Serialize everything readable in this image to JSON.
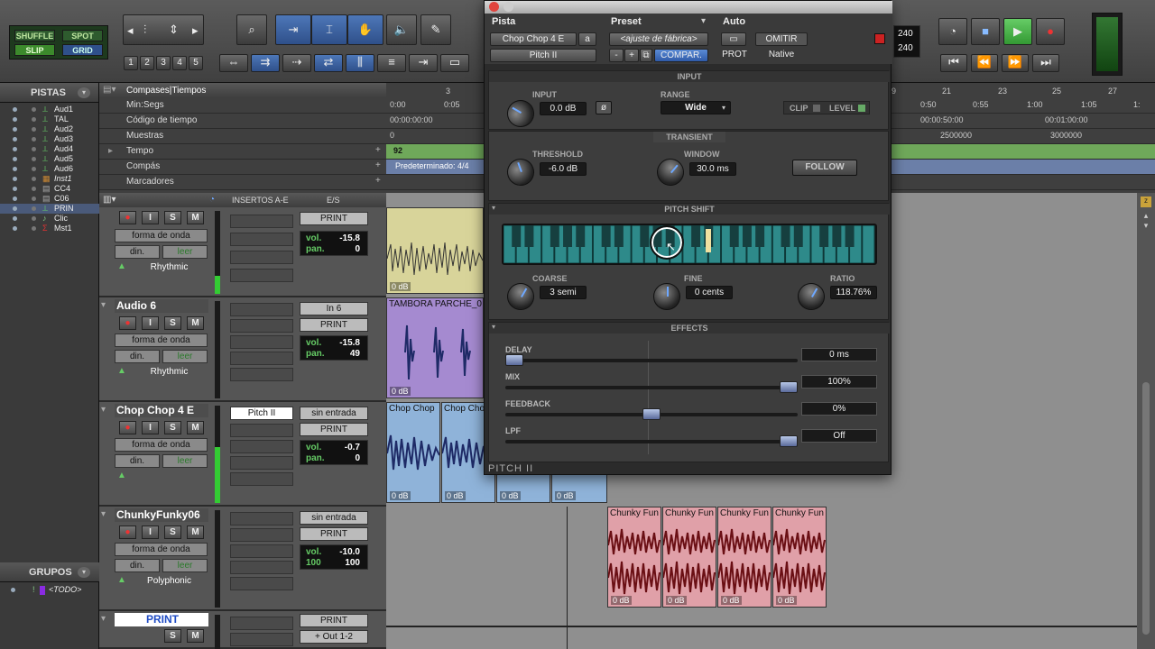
{
  "toolbar": {
    "modes": [
      "SHUFFLE",
      "SPOT",
      "SLIP",
      "GRID"
    ],
    "zoom_presets": [
      "1",
      "2",
      "3",
      "4",
      "5"
    ],
    "counter_top": "240",
    "counter_bottom": "240"
  },
  "left": {
    "tracks_header": "PISTAS",
    "track_list": [
      "Aud1",
      "TAL",
      "Aud2",
      "Aud3",
      "Aud4",
      "Aud5",
      "Aud6",
      "Inst1",
      "CC4",
      "C06",
      "PRIN",
      "Clic",
      "Mst1"
    ],
    "groups_header": "GRUPOS",
    "group_item": "<TODO>"
  },
  "rulers": {
    "header": "Compases|Tiempos",
    "rows": [
      "Min:Segs",
      "Código de tiempo",
      "Muestras",
      "Tempo",
      "Compás",
      "Marcadores"
    ],
    "bars_left": [
      "3"
    ],
    "bars_right": [
      "9",
      "21",
      "23",
      "25",
      "27"
    ],
    "minsecs_left": [
      "0:00",
      "0:05"
    ],
    "minsecs_right": [
      "0:50",
      "0:55",
      "1:00",
      "1:05",
      "1:"
    ],
    "timecode_left": "00:00:00:00",
    "timecode_right": [
      "00:00:50:00",
      "00:01:00:00"
    ],
    "samples_left": "0",
    "samples_right": [
      "2500000",
      "3000000"
    ],
    "tempo": "92",
    "meter": "Predeterminado: 4/4"
  },
  "edit_header": {
    "inserts": "INSERTOS A-E",
    "io": "E/S"
  },
  "tracks": [
    {
      "name": "",
      "view": "forma de onda",
      "din": "din.",
      "leer": "leer",
      "group": "Rhythmic",
      "io1": "PRINT",
      "vol": "-15.8",
      "pan": "0",
      "insert": ""
    },
    {
      "name": "Audio 6",
      "view": "forma de onda",
      "din": "din.",
      "leer": "leer",
      "group": "Rhythmic",
      "io0": "In 6",
      "io1": "PRINT",
      "vol": "-15.8",
      "pan": "49",
      "insert": ""
    },
    {
      "name": "Chop Chop 4 E",
      "view": "forma de onda",
      "din": "din.",
      "leer": "leer",
      "group": "",
      "io0": "sin entrada",
      "io1": "PRINT",
      "vol": "-0.7",
      "pan": "0",
      "insert": "Pitch II"
    },
    {
      "name": "ChunkyFunky06",
      "view": "forma de onda",
      "din": "din.",
      "leer": "leer",
      "group": "Polyphonic",
      "io0": "sin entrada",
      "io1": "PRINT",
      "vol": "-10.0",
      "pan_l": "100",
      "pan_r": "100",
      "insert": ""
    },
    {
      "name": "PRINT",
      "io1": "PRINT",
      "io2": "+ Out 1-2"
    }
  ],
  "clips": {
    "db": "0 dB",
    "tambora": "TAMBORA PARCHE_0",
    "chop": "Chop Chop",
    "chunky": "Chunky Fun"
  },
  "plugin": {
    "hdr_pista": "Pista",
    "hdr_preset": "Preset",
    "hdr_auto": "Auto",
    "track_sel": "Chop Chop 4 E",
    "track_letter": "a",
    "preset_sel": "<ajuste de fábrica>",
    "compar": "COMPAR.",
    "omitir": "OMITIR",
    "prot": "PROT",
    "native": "Native",
    "plugin_sel": "Pitch II",
    "minus": "-",
    "plus": "+",
    "input_title": "INPUT",
    "input_label": "INPUT",
    "input_value": "0.0 dB",
    "range_label": "RANGE",
    "range_value": "Wide",
    "clip_label": "CLIP",
    "level_label": "LEVEL",
    "transient_title": "TRANSIENT",
    "threshold_label": "THRESHOLD",
    "threshold_value": "-6.0 dB",
    "window_label": "WINDOW",
    "window_value": "30.0 ms",
    "follow_label": "FOLLOW",
    "pitch_title": "PITCH SHIFT",
    "coarse_label": "COARSE",
    "coarse_value": "3 semi",
    "fine_label": "FINE",
    "fine_value": "0 cents",
    "ratio_label": "RATIO",
    "ratio_value": "118.76%",
    "effects_title": "EFFECTS",
    "delay_label": "DELAY",
    "delay_value": "0 ms",
    "delay_level": 0.0,
    "mix_label": "MIX",
    "mix_value": "100%",
    "mix_level": 1.0,
    "feedback_label": "FEEDBACK",
    "feedback_value": "0%",
    "feedback_level": 0.5,
    "lpf_label": "LPF",
    "lpf_value": "Off",
    "lpf_level": 1.0,
    "footer": "PITCH II",
    "accent": "#2e8a8a"
  }
}
